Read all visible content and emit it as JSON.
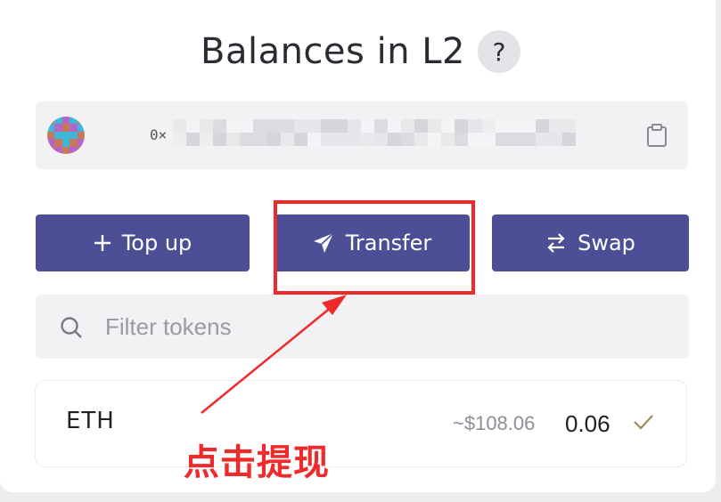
{
  "header": {
    "title": "Balances in L2",
    "help_icon": "?"
  },
  "account": {
    "address_prefix": "0×"
  },
  "actions": {
    "topup_label": "Top up",
    "transfer_label": "Transfer",
    "swap_label": "Swap"
  },
  "filter": {
    "placeholder": "Filter tokens"
  },
  "tokens": [
    {
      "symbol": "ETH",
      "usd_value": "~$108.06",
      "amount": "0.06"
    }
  ],
  "annotation": {
    "text": "点击提现"
  },
  "colors": {
    "accent": "#4d4f96",
    "annotation_red": "#ef2a2a"
  }
}
